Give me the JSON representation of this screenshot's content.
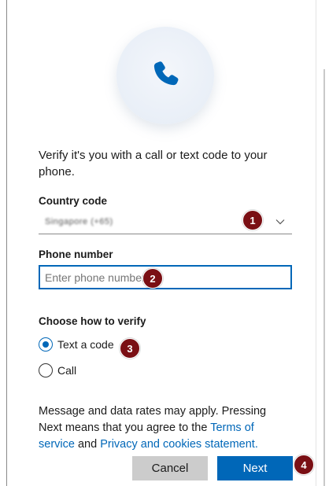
{
  "colors": {
    "accent": "#0067b8",
    "marker": "#7a0f14",
    "cancel_bg": "#cccccc"
  },
  "header": {
    "icon": "phone-icon"
  },
  "intro_text": "Verify it's you with a call or text code to your phone.",
  "country": {
    "label": "Country code",
    "value": "Singapore (+65)"
  },
  "phone": {
    "label": "Phone number",
    "placeholder": "Enter phone number"
  },
  "verify": {
    "label": "Choose how to verify",
    "options": [
      {
        "label": "Text a code",
        "selected": true
      },
      {
        "label": "Call",
        "selected": false
      }
    ]
  },
  "disclaimer": {
    "prefix": "Message and data rates may apply. Pressing Next means that you agree to the ",
    "terms_link": "Terms of service",
    "middle": " and ",
    "privacy_link": "Privacy and cookies statement",
    "suffix": "."
  },
  "buttons": {
    "cancel": "Cancel",
    "next": "Next"
  },
  "markers": [
    "1",
    "2",
    "3",
    "4"
  ]
}
